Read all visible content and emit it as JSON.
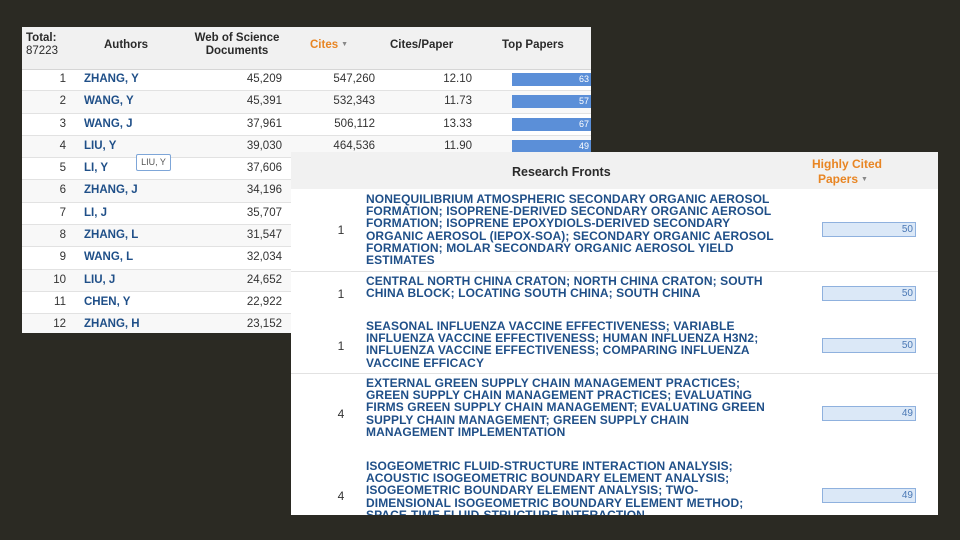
{
  "authors_table": {
    "headers": {
      "total_label": "Total:",
      "total_value": "87223",
      "authors": "Authors",
      "docs_line1": "Web of Science",
      "docs_line2": "Documents",
      "cites": "Cites",
      "cites_per_paper": "Cites/Paper",
      "top_papers": "Top Papers"
    },
    "rows": [
      {
        "rank": "1",
        "name": "ZHANG, Y",
        "docs": "45,209",
        "cites": "547,260",
        "cpp": "12.10",
        "top": "63"
      },
      {
        "rank": "2",
        "name": "WANG, Y",
        "docs": "45,391",
        "cites": "532,343",
        "cpp": "11.73",
        "top": "57"
      },
      {
        "rank": "3",
        "name": "WANG, J",
        "docs": "37,961",
        "cites": "506,112",
        "cpp": "13.33",
        "top": "67"
      },
      {
        "rank": "4",
        "name": "LIU, Y",
        "docs": "39,030",
        "cites": "464,536",
        "cpp": "11.90",
        "top": "49"
      },
      {
        "rank": "5",
        "name": "LI, Y",
        "docs": "37,606",
        "cites": "",
        "cpp": "",
        "top": ""
      },
      {
        "rank": "6",
        "name": "ZHANG, J",
        "docs": "34,196",
        "cites": "",
        "cpp": "",
        "top": ""
      },
      {
        "rank": "7",
        "name": "LI, J",
        "docs": "35,707",
        "cites": "",
        "cpp": "",
        "top": ""
      },
      {
        "rank": "8",
        "name": "ZHANG, L",
        "docs": "31,547",
        "cites": "",
        "cpp": "",
        "top": ""
      },
      {
        "rank": "9",
        "name": "WANG, L",
        "docs": "32,034",
        "cites": "",
        "cpp": "",
        "top": ""
      },
      {
        "rank": "10",
        "name": "LIU, J",
        "docs": "24,652",
        "cites": "",
        "cpp": "",
        "top": ""
      },
      {
        "rank": "11",
        "name": "CHEN, Y",
        "docs": "22,922",
        "cites": "",
        "cpp": "",
        "top": ""
      },
      {
        "rank": "12",
        "name": "ZHANG, H",
        "docs": "23,152",
        "cites": "",
        "cpp": "",
        "top": ""
      }
    ],
    "tooltip": "LIU, Y"
  },
  "fronts_table": {
    "headers": {
      "research_fronts": "Research Fronts",
      "highly_cited_line1": "Highly Cited",
      "highly_cited_line2": "Papers"
    },
    "rows": [
      {
        "rank": "1",
        "text": "NONEQUILIBRIUM ATMOSPHERIC SECONDARY ORGANIC AEROSOL FORMATION; ISOPRENE-DERIVED SECONDARY ORGANIC AEROSOL FORMATION; ISOPRENE EPOXYDIOLS-DERIVED SECONDARY ORGANIC AEROSOL (IEPOX-SOA); SECONDARY ORGANIC AEROSOL FORMATION; MOLAR SECONDARY ORGANIC AEROSOL YIELD ESTIMATES",
        "papers": "50"
      },
      {
        "rank": "1",
        "text": "CENTRAL NORTH CHINA CRATON; NORTH CHINA CRATON; SOUTH CHINA BLOCK; LOCATING SOUTH CHINA; SOUTH CHINA",
        "papers": "50"
      },
      {
        "rank": "1",
        "text": "SEASONAL INFLUENZA VACCINE EFFECTIVENESS; VARIABLE INFLUENZA VACCINE EFFECTIVENESS; HUMAN INFLUENZA H3N2; INFLUENZA VACCINE EFFECTIVENESS; COMPARING INFLUENZA VACCINE EFFICACY",
        "papers": "50"
      },
      {
        "rank": "4",
        "text": "EXTERNAL GREEN SUPPLY CHAIN MANAGEMENT PRACTICES; GREEN SUPPLY CHAIN MANAGEMENT PRACTICES; EVALUATING FIRMS GREEN SUPPLY CHAIN MANAGEMENT; EVALUATING GREEN SUPPLY CHAIN MANAGEMENT; GREEN SUPPLY CHAIN MANAGEMENT IMPLEMENTATION",
        "papers": "49"
      },
      {
        "rank": "4",
        "text": "ISOGEOMETRIC FLUID-STRUCTURE INTERACTION ANALYSIS; ACOUSTIC ISOGEOMETRIC BOUNDARY ELEMENT ANALYSIS; ISOGEOMETRIC BOUNDARY ELEMENT ANALYSIS; TWO-DIMENSIONAL ISOGEOMETRIC BOUNDARY ELEMENT METHOD; SPACE-TIME FLUID-STRUCTURE INTERACTION",
        "papers": "49"
      }
    ]
  },
  "colors": {
    "background": "#2b2a23",
    "link": "#1f4f88",
    "sort_accent": "#e88523",
    "bar": "#5b8fd8"
  },
  "icons": {
    "sort": "caret-down-icon"
  }
}
